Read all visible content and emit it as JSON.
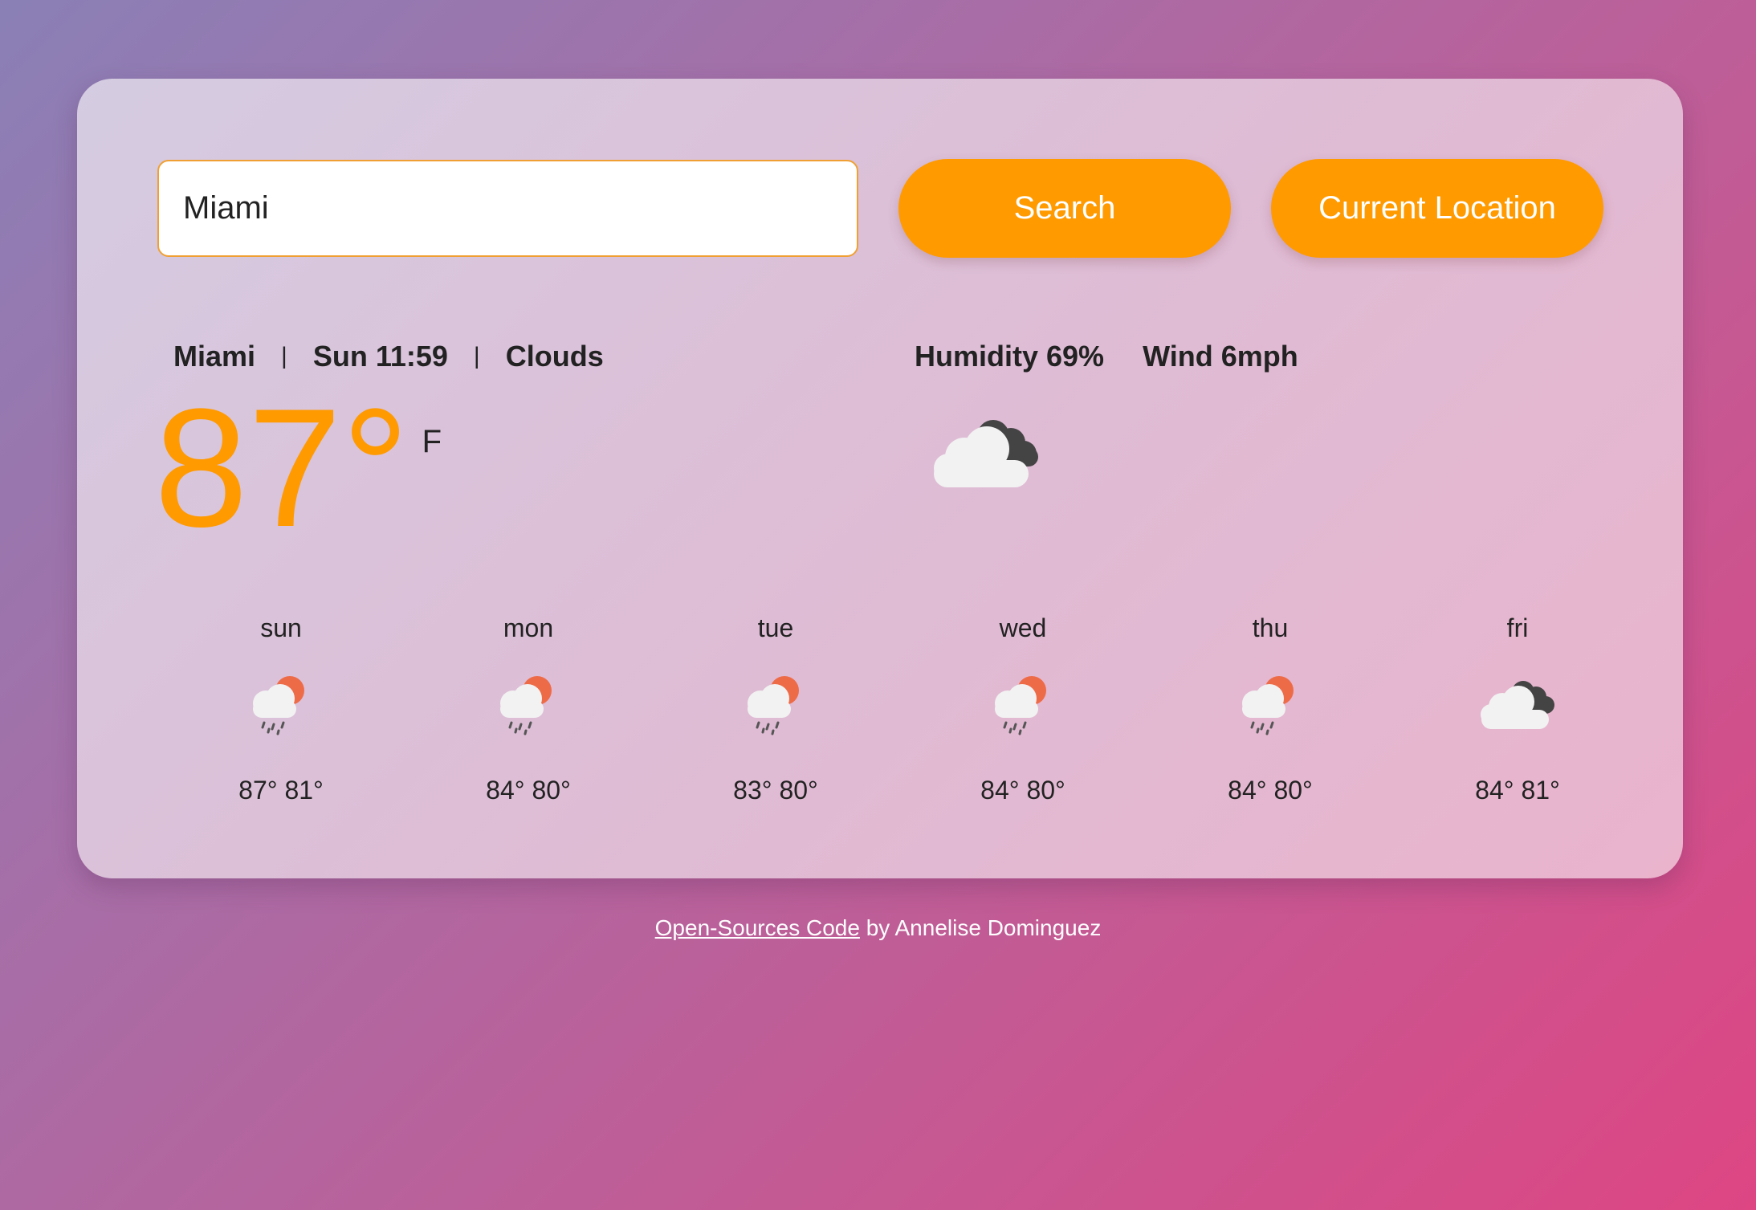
{
  "search": {
    "value": "Miami",
    "search_label": "Search",
    "location_label": "Current Location"
  },
  "current": {
    "city": "Miami",
    "separator": "|",
    "datetime": "Sun 11:59",
    "condition": "Clouds",
    "humidity": "Humidity 69%",
    "wind": "Wind 6mph",
    "temperature": "87°",
    "unit": "F",
    "icon": "broken-clouds-icon"
  },
  "forecast": [
    {
      "day": "sun",
      "temps": "87° 81°",
      "icon": "rain-sun-icon"
    },
    {
      "day": "mon",
      "temps": "84° 80°",
      "icon": "rain-sun-icon"
    },
    {
      "day": "tue",
      "temps": "83° 80°",
      "icon": "rain-sun-icon"
    },
    {
      "day": "wed",
      "temps": "84° 80°",
      "icon": "rain-sun-icon"
    },
    {
      "day": "thu",
      "temps": "84° 80°",
      "icon": "rain-sun-icon"
    },
    {
      "day": "fri",
      "temps": "84° 81°",
      "icon": "broken-clouds-icon"
    }
  ],
  "footer": {
    "link_text": "Open-Sources Code",
    "by_text": " by Annelise Dominguez"
  },
  "colors": {
    "accent": "#ff9a00",
    "background_start": "#8a80b6",
    "background_end": "#dd4683"
  }
}
